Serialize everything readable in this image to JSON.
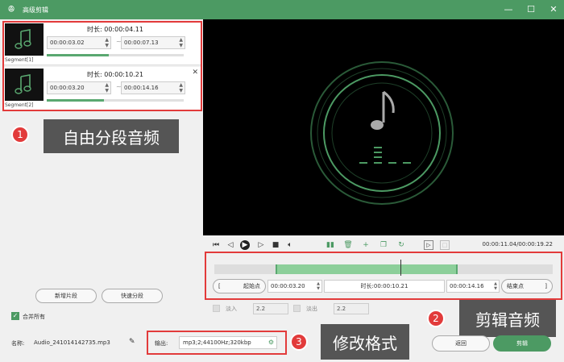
{
  "window": {
    "title": "高级剪辑",
    "min": "—",
    "max": "☐",
    "close": "✕"
  },
  "segments": [
    {
      "label": "Segment[1]",
      "duration_label": "时长:",
      "duration": "00:00:04.11",
      "start": "00:00:03.02",
      "end": "00:00:07.13",
      "progress": 0.45
    },
    {
      "label": "Segment[2]",
      "duration_label": "时长:",
      "duration": "00:00:10.21",
      "start": "00:00:03.20",
      "end": "00:00:14.16",
      "progress": 0.42
    }
  ],
  "segment_tilde": "~",
  "left_buttons": {
    "new_segment": "新增片段",
    "quick_split": "快速分段"
  },
  "merge_all": "合并所有",
  "filename": {
    "label": "名称:",
    "value": "Audio_241014142735.mp3"
  },
  "output": {
    "label": "输出:",
    "value": "mp3;2;44100Hz;320kbp"
  },
  "playback": {
    "timecode": "00:00:11.04/00:00:19.22"
  },
  "timeline": {
    "start_btn": "起始点",
    "start_value": "00:00:03.20",
    "duration_label": "时长:",
    "duration_value": "00:00:10.21",
    "end_value": "00:00:14.16",
    "end_btn": "结束点",
    "selection_start": 0.18,
    "selection_end": 0.72,
    "playhead": 0.55
  },
  "fade": {
    "in_label": "淡入",
    "in_value": "2.2",
    "out_label": "淡出",
    "out_value": "2.2"
  },
  "actions": {
    "back": "返回",
    "cut": "剪辑"
  },
  "annotations": [
    {
      "num": "1",
      "text": "自由分段音频"
    },
    {
      "num": "2",
      "text": "剪辑音频"
    },
    {
      "num": "3",
      "text": "修改格式"
    }
  ],
  "colors": {
    "accent": "#4c9a63",
    "highlight": "#e23b3b"
  }
}
